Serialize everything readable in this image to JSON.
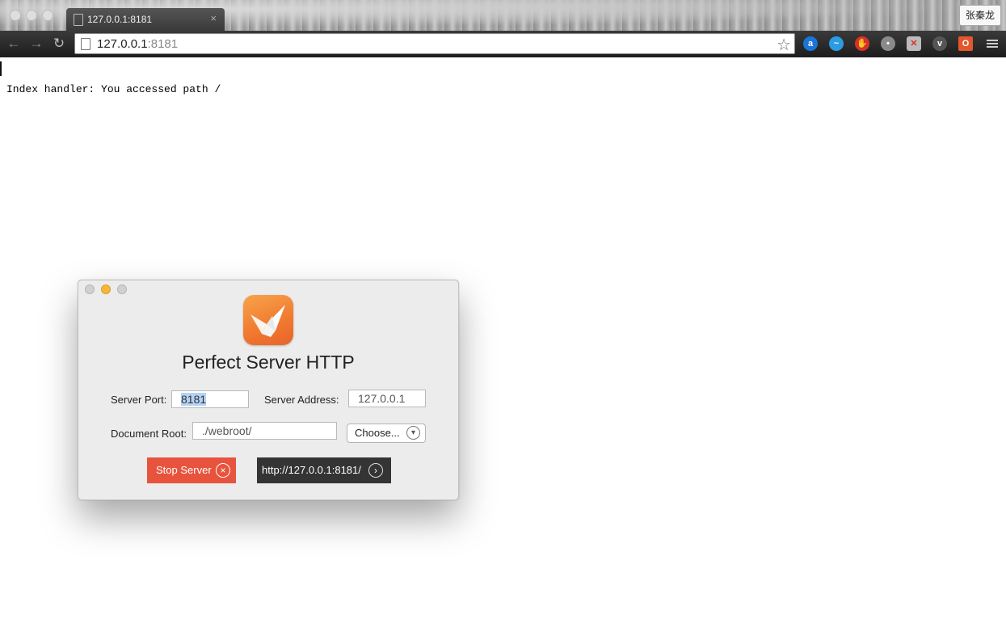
{
  "browser": {
    "tab": {
      "title": "127.0.0.1:8181",
      "close_glyph": "×"
    },
    "profile_name": "张秦龙",
    "address": {
      "host": "127.0.0.1",
      "port": ":8181"
    },
    "nav": {
      "back": "←",
      "forward": "→",
      "reload": "↻"
    },
    "star": "☆",
    "extensions": [
      {
        "name": "a-extension-icon",
        "glyph": "a",
        "color": "#1b74d8"
      },
      {
        "name": "pulse-extension-icon",
        "glyph": "~",
        "color": "#2b9be2"
      },
      {
        "name": "hand-stop-extension-icon",
        "glyph": "✋",
        "color": "#d9302a"
      },
      {
        "name": "dots-extension-icon",
        "glyph": "•",
        "color": "#8a8a8a"
      },
      {
        "name": "block-extension-icon",
        "glyph": "✕",
        "color": "#bbbbbb"
      },
      {
        "name": "pocket-extension-icon",
        "glyph": "v",
        "color": "#555555"
      },
      {
        "name": "office-extension-icon",
        "glyph": "O",
        "color": "#e4572e"
      }
    ]
  },
  "page": {
    "text": "Index handler: You accessed path /"
  },
  "app": {
    "title": "Perfect Server HTTP",
    "server_port_label": "Server Port:",
    "server_port_value": "8181",
    "server_address_label": "Server Address:",
    "server_address_value": "127.0.0.1",
    "document_root_label": "Document Root:",
    "document_root_value": "./webroot/",
    "choose_label": "Choose...",
    "stop_label": "Stop Server",
    "url_label": "http://127.0.0.1:8181/",
    "colors": {
      "stop": "#e8533d",
      "url_button": "#343434",
      "icon": "#f0792f"
    }
  }
}
